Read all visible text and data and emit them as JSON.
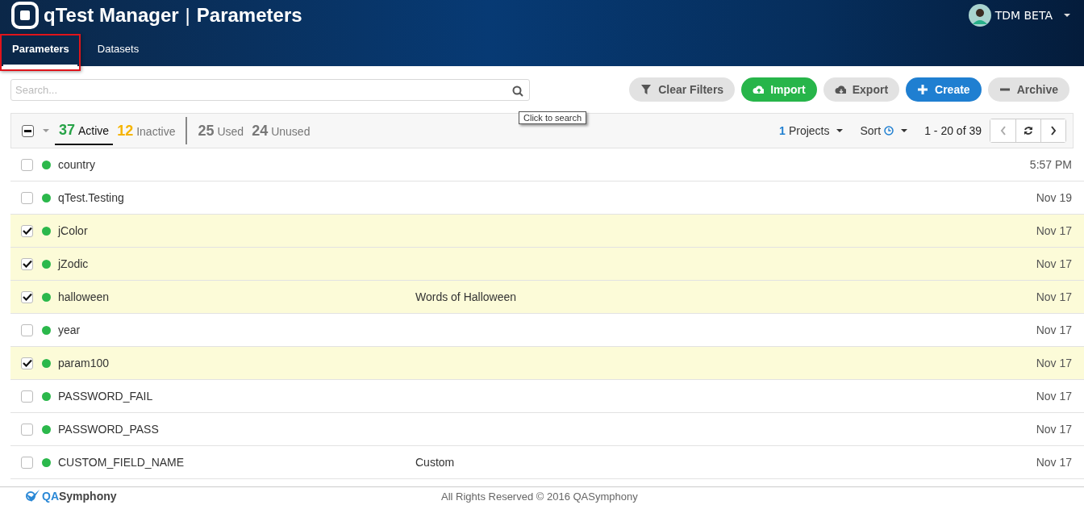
{
  "header": {
    "logo_text": "qTest Manager",
    "separator": "|",
    "page_title": "Parameters",
    "user": "TDM BETA"
  },
  "tabs": [
    {
      "label": "Parameters",
      "selected": true,
      "highlighted": true
    },
    {
      "label": "Datasets",
      "selected": false,
      "highlighted": false
    }
  ],
  "search": {
    "placeholder": "Search...",
    "tooltip": "Click to search"
  },
  "actions": [
    {
      "label": "Clear Filters",
      "kind": "filter"
    },
    {
      "label": "Import",
      "kind": "import"
    },
    {
      "label": "Export",
      "kind": "export"
    },
    {
      "label": "Create",
      "kind": "create"
    },
    {
      "label": "Archive",
      "kind": "archive"
    }
  ],
  "select_all": {
    "indeterminate": true
  },
  "filters": [
    {
      "count": "37",
      "label": "Active",
      "kind": "active",
      "selected": true
    },
    {
      "count": "12",
      "label": "Inactive",
      "kind": "inactive",
      "selected": false
    },
    {
      "count": "25",
      "label": "Used",
      "kind": "plain",
      "selected": false
    },
    {
      "count": "24",
      "label": "Unused",
      "kind": "plain",
      "selected": false
    }
  ],
  "projects": {
    "count": "1",
    "label": "Projects"
  },
  "sort": {
    "label": "Sort"
  },
  "pagination": "1 - 20 of 39",
  "rows": [
    {
      "name": "country",
      "date": "5:57 PM",
      "checked": false,
      "active": true
    },
    {
      "name": "qTest.Testing",
      "date": "Nov 19",
      "checked": false,
      "active": true
    },
    {
      "name": "jColor",
      "date": "Nov 17",
      "checked": true,
      "active": true
    },
    {
      "name": "jZodic",
      "date": "Nov 17",
      "checked": true,
      "active": true
    },
    {
      "name": "halloween",
      "description": "Words of Halloween",
      "date": "Nov 17",
      "checked": true,
      "active": true
    },
    {
      "name": "year",
      "date": "Nov 17",
      "checked": false,
      "active": true
    },
    {
      "name": "param100",
      "date": "Nov 17",
      "checked": true,
      "active": true
    },
    {
      "name": "PASSWORD_FAIL",
      "date": "Nov 17",
      "checked": false,
      "active": true
    },
    {
      "name": "PASSWORD_PASS",
      "date": "Nov 17",
      "checked": false,
      "active": true
    },
    {
      "name": "CUSTOM_FIELD_NAME",
      "description": "Custom",
      "date": "Nov 17",
      "checked": false,
      "active": true
    }
  ],
  "footer": {
    "brand_prefix": "QA",
    "brand_suffix": "Symphony",
    "copyright": "All Rights Reserved © 2016 QASymphony"
  }
}
